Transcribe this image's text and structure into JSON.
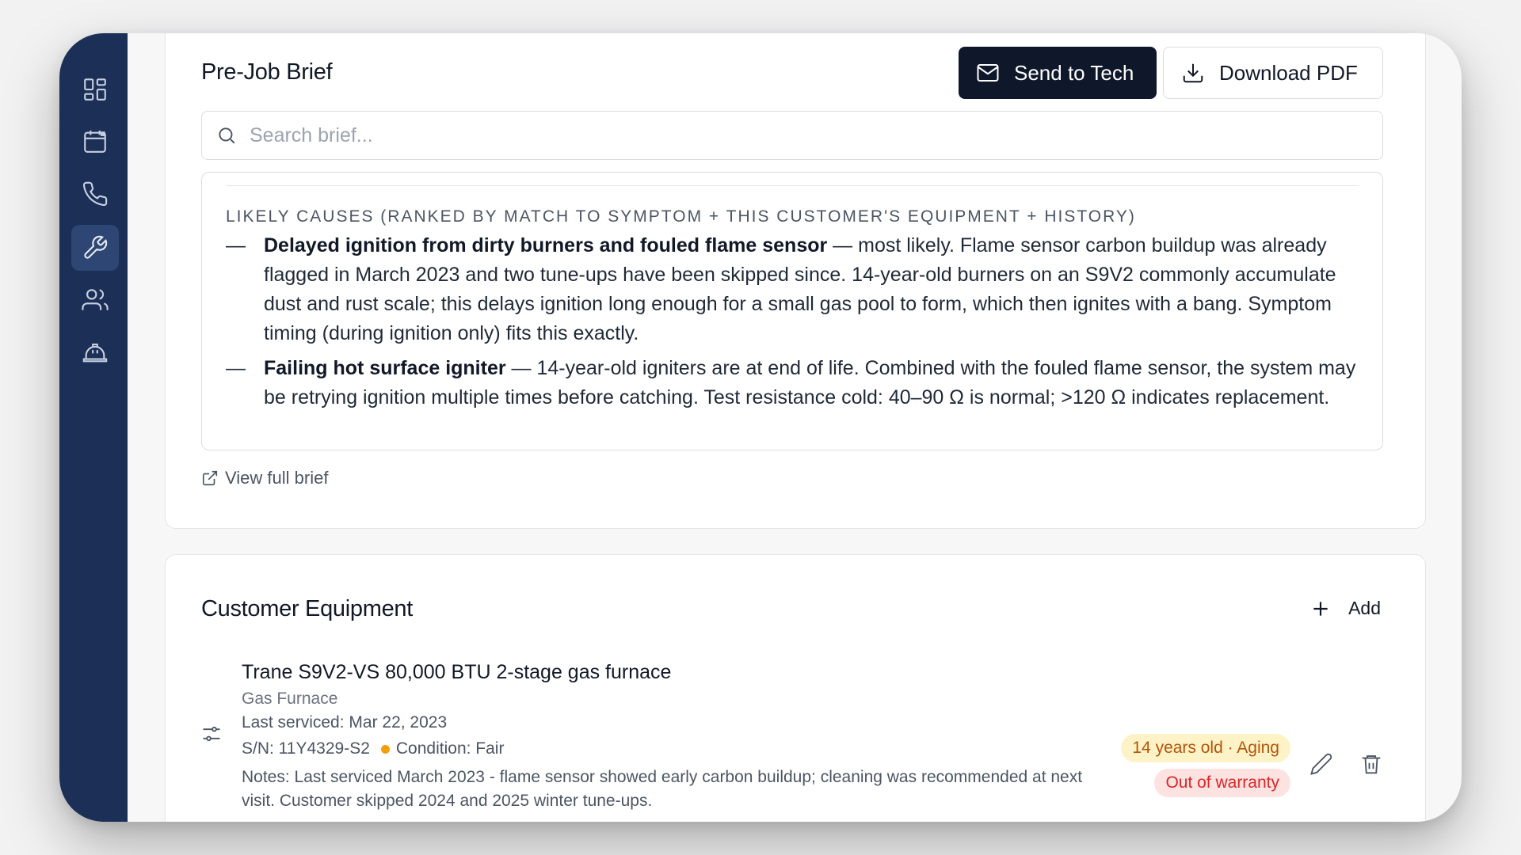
{
  "sidebar": {
    "items": [
      {
        "name": "dashboard",
        "icon": "grid-icon",
        "active": false
      },
      {
        "name": "calendar",
        "icon": "calendar-icon",
        "active": false
      },
      {
        "name": "calls",
        "icon": "phone-icon",
        "active": false
      },
      {
        "name": "jobs",
        "icon": "wrench-icon",
        "active": true
      },
      {
        "name": "customers",
        "icon": "users-icon",
        "active": false
      },
      {
        "name": "technicians",
        "icon": "hard-hat-icon",
        "active": false
      }
    ]
  },
  "brief": {
    "title": "Pre-Job Brief",
    "send_label": "Send to Tech",
    "download_label": "Download PDF",
    "search_placeholder": "Search brief...",
    "section_label": "LIKELY CAUSES (RANKED BY MATCH TO SYMPTOM + THIS CUSTOMER'S EQUIPMENT + HISTORY)",
    "causes": [
      {
        "dash": "—",
        "title": "Delayed ignition from dirty burners and fouled flame sensor",
        "text": " — most likely. Flame sensor carbon buildup was already flagged in March 2023 and two tune-ups have been skipped since. 14-year-old burners on an S9V2 commonly accumulate dust and rust scale; this delays ignition long enough for a small gas pool to form, which then ignites with a bang. Symptom timing (during ignition only) fits this exactly."
      },
      {
        "dash": "—",
        "title": "Failing hot surface igniter",
        "text": " — 14-year-old igniters are at end of life. Combined with the fouled flame sensor, the system may be retrying ignition multiple times before catching. Test resistance cold: 40–90 Ω is normal; >120 Ω indicates replacement."
      }
    ],
    "view_full_label": "View full brief"
  },
  "equipment": {
    "title": "Customer Equipment",
    "add_label": "Add",
    "items": [
      {
        "name": "Trane S9V2-VS 80,000 BTU 2-stage gas furnace",
        "type": "Gas Furnace",
        "last_serviced": "Last serviced: Mar 22, 2023",
        "serial": "S/N: 11Y4329-S2",
        "condition": "Condition: Fair",
        "notes": "Notes: Last serviced March 2023 - flame sensor showed early carbon buildup; cleaning was recommended at next visit. Customer skipped 2024 and 2025 winter tune-ups.",
        "age_badge": "14 years old · Aging",
        "warranty_badge": "Out of warranty"
      }
    ]
  },
  "colors": {
    "sidebar": "#1b2f57",
    "primary_button": "#0f172a",
    "age_badge_bg": "#fdf3c7",
    "warranty_badge_bg": "#fde2e2",
    "condition_dot": "#f59e0b"
  }
}
